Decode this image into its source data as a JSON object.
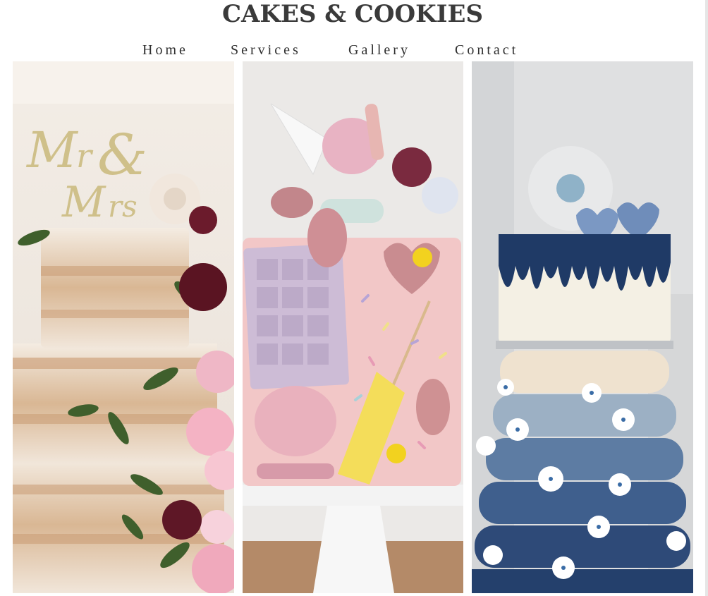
{
  "header": {
    "title": "CAKES & COOKIES"
  },
  "nav": {
    "items": [
      {
        "label": "Home"
      },
      {
        "label": "Services"
      },
      {
        "label": "Gallery"
      },
      {
        "label": "Contact"
      }
    ]
  },
  "gallery": {
    "images": [
      {
        "subject": "naked-wedding-cake",
        "topper_text": "Mr & Mrs"
      },
      {
        "subject": "pink-drip-cake"
      },
      {
        "subject": "blue-macaron-tower-cake"
      }
    ]
  },
  "colors": {
    "title": "#3a3a3a",
    "nav_text": "#2e2e2e",
    "background": "#ffffff"
  }
}
